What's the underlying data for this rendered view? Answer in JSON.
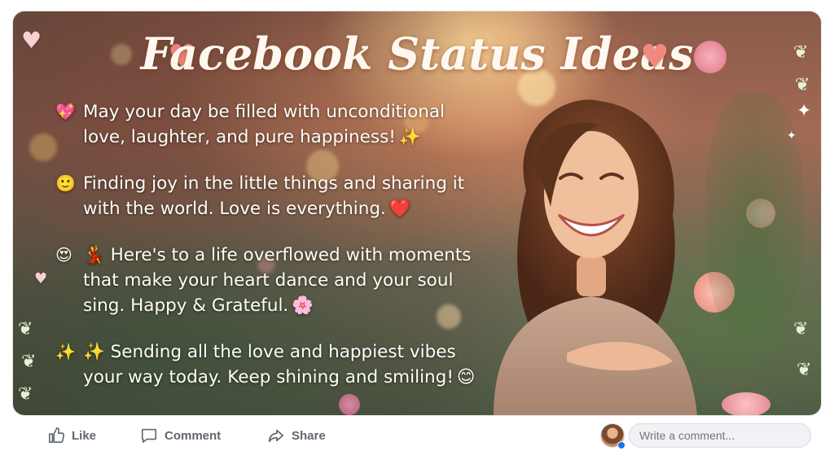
{
  "post": {
    "title": "Facebook Status Ideas",
    "statuses": [
      {
        "emoji": "💖",
        "text": "May your day be filled with unconditional love, laughter, and pure happiness!",
        "trail": "✨"
      },
      {
        "emoji": "🙂",
        "text": "Finding joy in the little things and sharing it with the world. Love is everything.",
        "trail": "❤️"
      },
      {
        "emoji": "😍",
        "text": "💃 Here's to a life overflowed with moments that make your heart dance and your soul sing. Happy & Grateful.",
        "trail": "🌸"
      },
      {
        "emoji": "✨",
        "text": "✨ Sending all the love and happiest vibes your way today. Keep shining and smiling!",
        "trail": "😊"
      }
    ]
  },
  "actions": {
    "like_label": "Like",
    "comment_label": "Comment",
    "share_label": "Share",
    "comment_placeholder": "Write a comment..."
  },
  "colors": {
    "action_text": "#606770",
    "accent_heart": "#f08a7e",
    "brand_blue": "#1877f2"
  }
}
